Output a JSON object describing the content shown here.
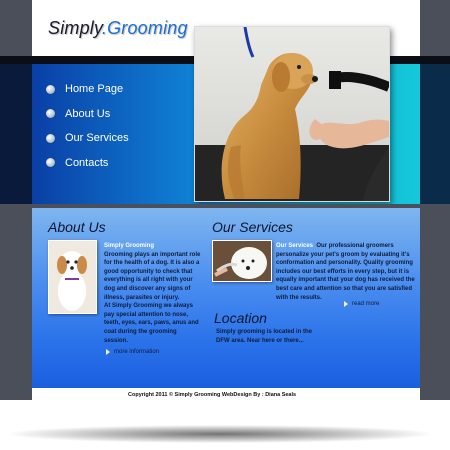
{
  "site": {
    "logo_main": "Simply",
    "logo_accent": ".Grooming"
  },
  "nav": {
    "items": [
      {
        "label": "Home Page"
      },
      {
        "label": "About Us"
      },
      {
        "label": "Our Services"
      },
      {
        "label": "Contacts"
      }
    ]
  },
  "about": {
    "heading": "About Us",
    "highlight": "Simply Grooming",
    "text1": "Grooming plays an important role for the health of a dog. It is also a good opportunity to check that everything is all right with your dog and discover any signs of illness, parasites or injury.",
    "text2": "At Simply Grooming we always pay special attention to nose, teeth, eyes, ears, paws, anus and coat during the grooming session.",
    "more": "more information"
  },
  "services": {
    "heading": "Our Services",
    "highlight": "Our Services",
    "text": "Our professional groomers personalize your pet's groom by evaluating it's conformation and personality. Quality grooming includes our best efforts in every step, but it is equally important that your dog has received the best care and attention so that you are satisfied with the results.",
    "more": "read more"
  },
  "location": {
    "heading": "Location",
    "text": "Simply grooming is located in the DFW area. Near here or there..."
  },
  "footer": {
    "text": "Copyright 2011 © Simply Grooming  WebDesign By : Diana Seals"
  },
  "colors": {
    "accent": "#1e6fd0",
    "banner": "#10b6d6",
    "content": "#4c8ff0",
    "side": "#4a4f5a"
  }
}
